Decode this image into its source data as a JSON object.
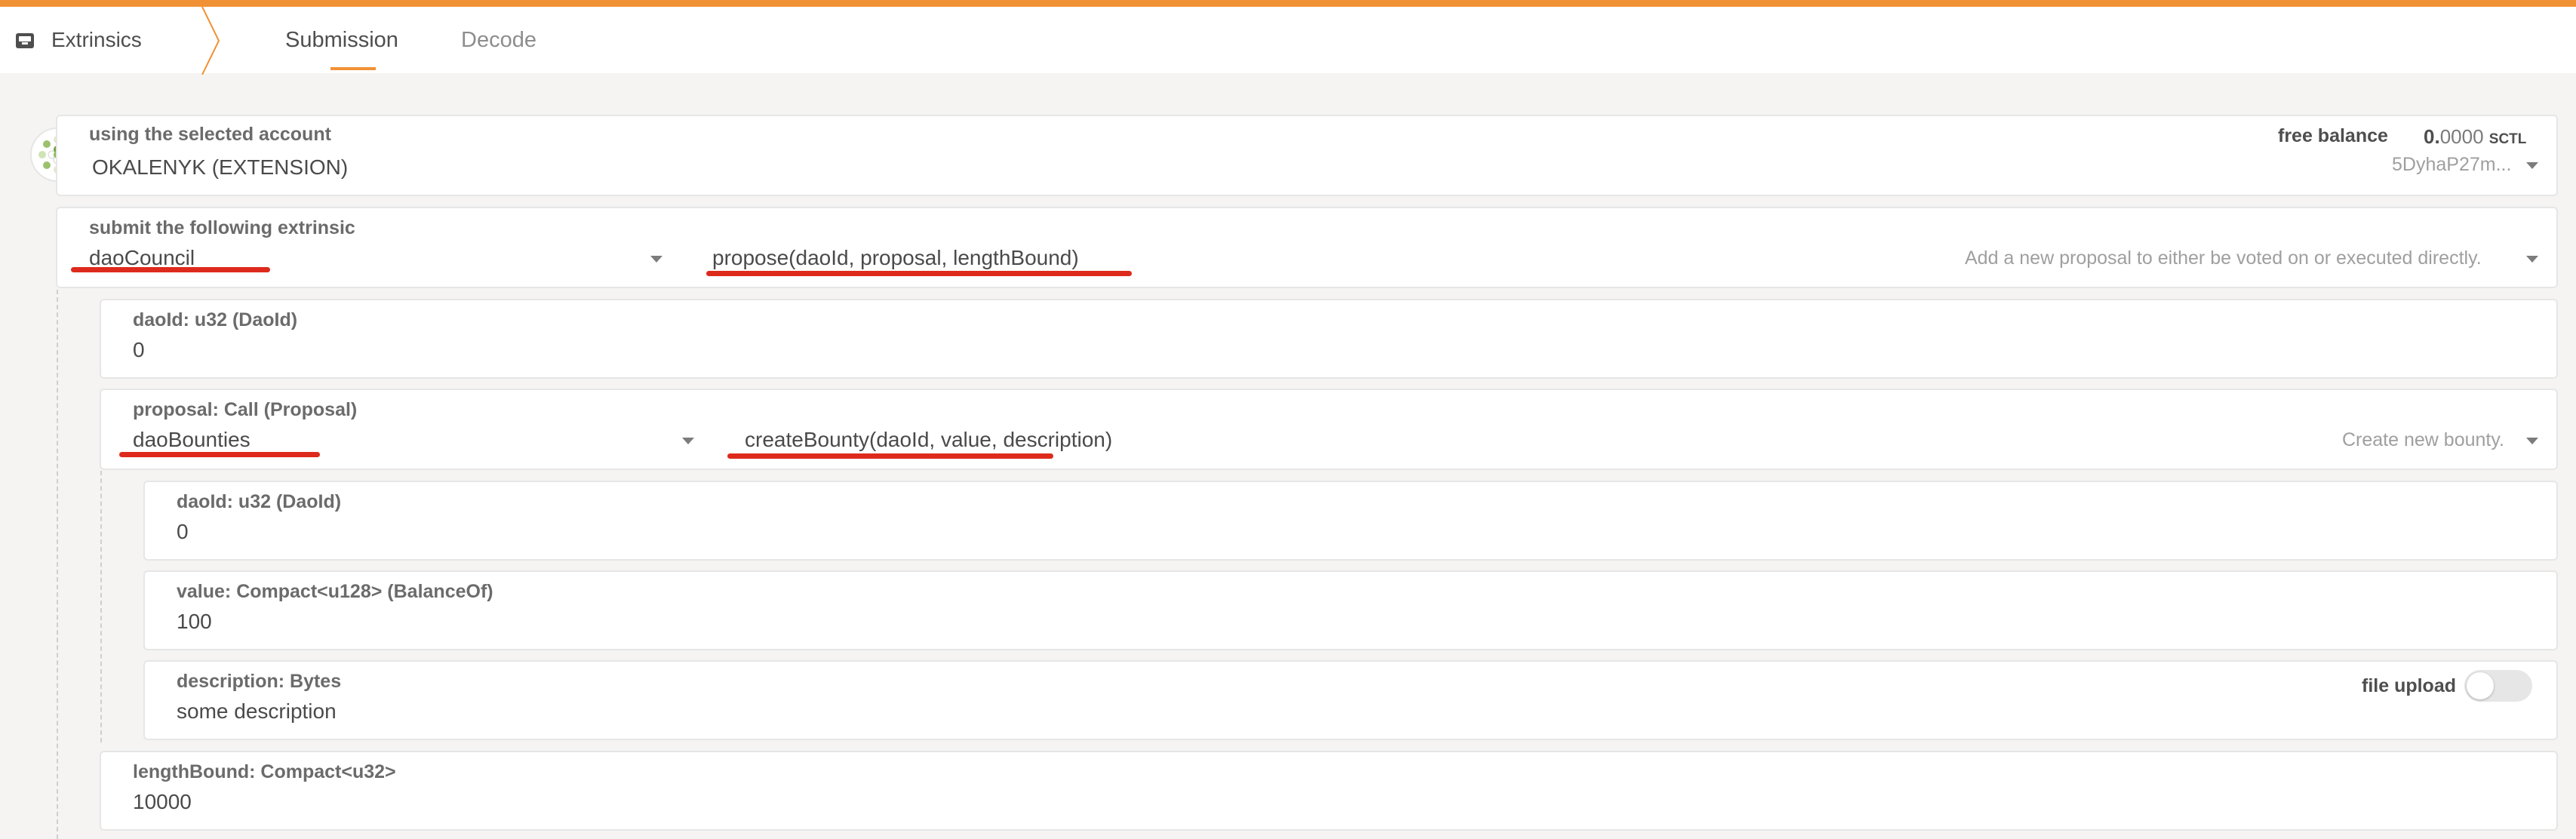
{
  "header": {
    "app_title": "Extrinsics",
    "app_icon": "inbox-icon",
    "tabs": [
      {
        "label": "Submission",
        "active": true
      },
      {
        "label": "Decode",
        "active": false
      }
    ]
  },
  "account": {
    "label": "using the selected account",
    "name": "OKALENYK (EXTENSION)",
    "free_balance_label": "free balance",
    "balance_int": "0.",
    "balance_dec": "0000",
    "balance_unit": "SCTL",
    "address": "5DyhaP27m..."
  },
  "extrinsic": {
    "label": "submit the following extrinsic",
    "section": "daoCouncil",
    "method": "propose(daoId, proposal, lengthBound)",
    "description": "Add a new proposal to either be voted on or executed directly."
  },
  "params": {
    "dao_id": {
      "label": "daoId: u32 (DaoId)",
      "value": "0"
    },
    "proposal": {
      "label": "proposal: Call (Proposal)",
      "section": "daoBounties",
      "method": "createBounty(daoId, value, description)",
      "description": "Create new bounty."
    },
    "inner_dao_id": {
      "label": "daoId: u32 (DaoId)",
      "value": "0"
    },
    "value": {
      "label": "value: Compact<u128> (BalanceOf)",
      "value": "100"
    },
    "description_param": {
      "label": "description: Bytes",
      "value": "some description",
      "file_upload_label": "file upload",
      "file_upload_on": false
    },
    "length_bound": {
      "label": "lengthBound: Compact<u32>",
      "value": "10000"
    }
  },
  "colors": {
    "accent": "#f19135",
    "annotation": "#dd2a1c"
  }
}
